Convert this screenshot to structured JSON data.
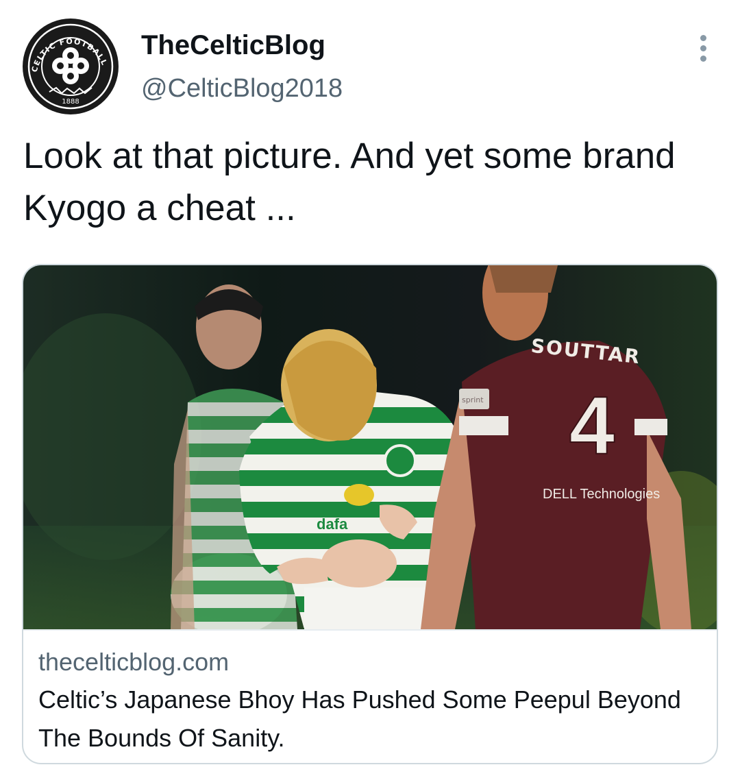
{
  "tweet": {
    "author": {
      "display_name": "TheCelticBlog",
      "handle": "@CelticBlog2018",
      "avatar_badge_text": "THE CELTIC FOOTBALL CLUB",
      "avatar_year": "1888"
    },
    "more_icon": "more-vertical-icon",
    "text": "Look at that picture. And yet some brand Kyogo a cheat ...",
    "card": {
      "domain": "thecelticblog.com",
      "title": "Celtic’s Japanese Bhoy Has Pushed Some Peepul Beyond The Bounds Of Sanity.",
      "image_text": {
        "player_name": "SOUTTAR",
        "player_number": "4",
        "sponsor": "DELL Technologies",
        "sleeve": "sprint",
        "shirt_sponsor": "dafa"
      }
    }
  },
  "colors": {
    "text_primary": "#0f1419",
    "text_secondary": "#536471",
    "card_border": "#cfd9de",
    "celtic_green": "#1c8a3f",
    "hearts_maroon": "#5a1e24"
  }
}
